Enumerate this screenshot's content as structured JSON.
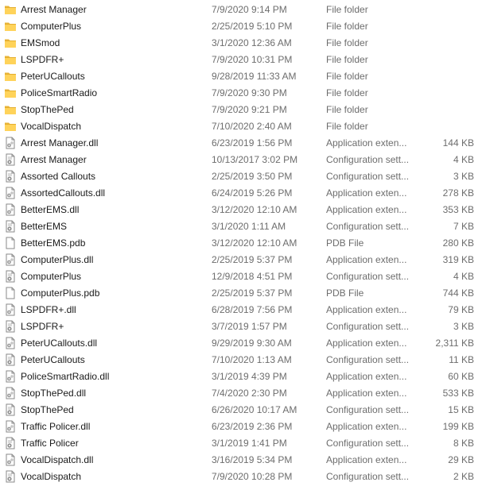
{
  "files": [
    {
      "name": "Arrest Manager",
      "date": "7/9/2020 9:14 PM",
      "type": "File folder",
      "size": "",
      "icon": "folder-icon"
    },
    {
      "name": "ComputerPlus",
      "date": "2/25/2019 5:10 PM",
      "type": "File folder",
      "size": "",
      "icon": "folder-icon"
    },
    {
      "name": "EMSmod",
      "date": "3/1/2020 12:36 AM",
      "type": "File folder",
      "size": "",
      "icon": "folder-icon"
    },
    {
      "name": "LSPDFR+",
      "date": "7/9/2020 10:31 PM",
      "type": "File folder",
      "size": "",
      "icon": "folder-icon"
    },
    {
      "name": "PeterUCallouts",
      "date": "9/28/2019 11:33 AM",
      "type": "File folder",
      "size": "",
      "icon": "folder-icon"
    },
    {
      "name": "PoliceSmartRadio",
      "date": "7/9/2020 9:30 PM",
      "type": "File folder",
      "size": "",
      "icon": "folder-icon"
    },
    {
      "name": "StopThePed",
      "date": "7/9/2020 9:21 PM",
      "type": "File folder",
      "size": "",
      "icon": "folder-icon"
    },
    {
      "name": "VocalDispatch",
      "date": "7/10/2020 2:40 AM",
      "type": "File folder",
      "size": "",
      "icon": "folder-icon"
    },
    {
      "name": "Arrest Manager.dll",
      "date": "6/23/2019 1:56 PM",
      "type": "Application exten...",
      "size": "144 KB",
      "icon": "dll-file-icon"
    },
    {
      "name": "Arrest Manager",
      "date": "10/13/2017 3:02 PM",
      "type": "Configuration sett...",
      "size": "4 KB",
      "icon": "config-file-icon"
    },
    {
      "name": "Assorted Callouts",
      "date": "2/25/2019 3:50 PM",
      "type": "Configuration sett...",
      "size": "3 KB",
      "icon": "config-file-icon"
    },
    {
      "name": "AssortedCallouts.dll",
      "date": "6/24/2019 5:26 PM",
      "type": "Application exten...",
      "size": "278 KB",
      "icon": "dll-file-icon"
    },
    {
      "name": "BetterEMS.dll",
      "date": "3/12/2020 12:10 AM",
      "type": "Application exten...",
      "size": "353 KB",
      "icon": "dll-file-icon"
    },
    {
      "name": "BetterEMS",
      "date": "3/1/2020 1:11 AM",
      "type": "Configuration sett...",
      "size": "7 KB",
      "icon": "config-file-icon"
    },
    {
      "name": "BetterEMS.pdb",
      "date": "3/12/2020 12:10 AM",
      "type": "PDB File",
      "size": "280 KB",
      "icon": "pdb-file-icon"
    },
    {
      "name": "ComputerPlus.dll",
      "date": "2/25/2019 5:37 PM",
      "type": "Application exten...",
      "size": "319 KB",
      "icon": "dll-file-icon"
    },
    {
      "name": "ComputerPlus",
      "date": "12/9/2018 4:51 PM",
      "type": "Configuration sett...",
      "size": "4 KB",
      "icon": "config-file-icon"
    },
    {
      "name": "ComputerPlus.pdb",
      "date": "2/25/2019 5:37 PM",
      "type": "PDB File",
      "size": "744 KB",
      "icon": "pdb-file-icon"
    },
    {
      "name": "LSPDFR+.dll",
      "date": "6/28/2019 7:56 PM",
      "type": "Application exten...",
      "size": "79 KB",
      "icon": "dll-file-icon"
    },
    {
      "name": "LSPDFR+",
      "date": "3/7/2019 1:57 PM",
      "type": "Configuration sett...",
      "size": "3 KB",
      "icon": "config-file-icon"
    },
    {
      "name": "PeterUCallouts.dll",
      "date": "9/29/2019 9:30 AM",
      "type": "Application exten...",
      "size": "2,311 KB",
      "icon": "dll-file-icon"
    },
    {
      "name": "PeterUCallouts",
      "date": "7/10/2020 1:13 AM",
      "type": "Configuration sett...",
      "size": "11 KB",
      "icon": "config-file-icon"
    },
    {
      "name": "PoliceSmartRadio.dll",
      "date": "3/1/2019 4:39 PM",
      "type": "Application exten...",
      "size": "60 KB",
      "icon": "dll-file-icon"
    },
    {
      "name": "StopThePed.dll",
      "date": "7/4/2020 2:30 PM",
      "type": "Application exten...",
      "size": "533 KB",
      "icon": "dll-file-icon"
    },
    {
      "name": "StopThePed",
      "date": "6/26/2020 10:17 AM",
      "type": "Configuration sett...",
      "size": "15 KB",
      "icon": "config-file-icon"
    },
    {
      "name": "Traffic Policer.dll",
      "date": "6/23/2019 2:36 PM",
      "type": "Application exten...",
      "size": "199 KB",
      "icon": "dll-file-icon"
    },
    {
      "name": "Traffic Policer",
      "date": "3/1/2019 1:41 PM",
      "type": "Configuration sett...",
      "size": "8 KB",
      "icon": "config-file-icon"
    },
    {
      "name": "VocalDispatch.dll",
      "date": "3/16/2019 5:34 PM",
      "type": "Application exten...",
      "size": "29 KB",
      "icon": "dll-file-icon"
    },
    {
      "name": "VocalDispatch",
      "date": "7/9/2020 10:28 PM",
      "type": "Configuration sett...",
      "size": "2 KB",
      "icon": "config-file-icon"
    }
  ]
}
